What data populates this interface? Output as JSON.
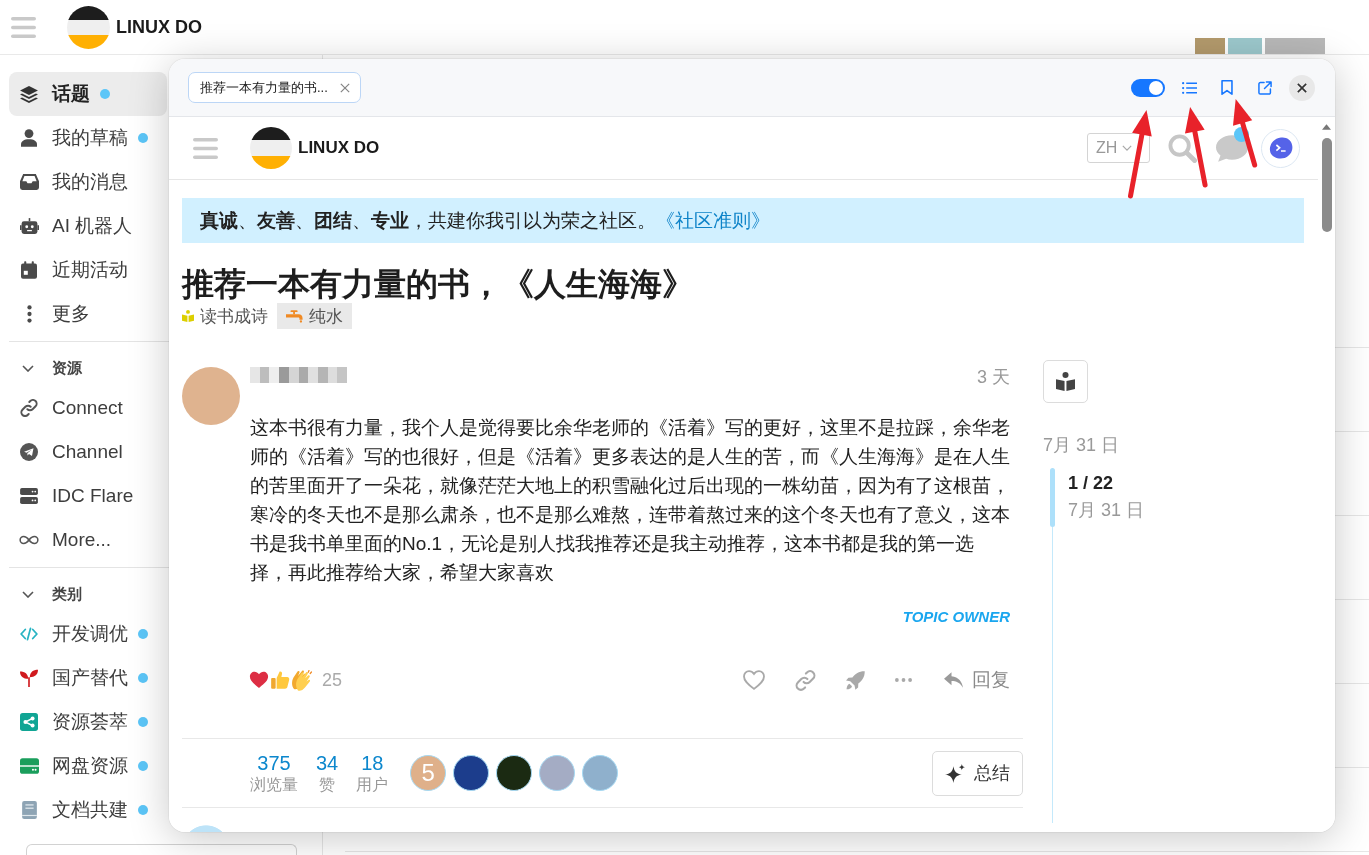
{
  "header": {
    "brand": "LINUX DO"
  },
  "sidebar": {
    "items": [
      {
        "label": "话题",
        "selected": true,
        "unread": true
      },
      {
        "label": "我的草稿",
        "selected": false,
        "unread": true
      },
      {
        "label": "我的消息",
        "selected": false,
        "unread": false
      },
      {
        "label": "AI 机器人",
        "selected": false,
        "unread": false
      },
      {
        "label": "近期活动",
        "selected": false,
        "unread": false
      },
      {
        "label": "更多",
        "selected": false,
        "unread": false
      }
    ],
    "sections": [
      {
        "title": "资源",
        "expanded": true,
        "items": [
          {
            "label": "Connect",
            "selected": false
          },
          {
            "label": "Channel",
            "selected": false
          },
          {
            "label": "IDC Flare",
            "selected": false
          },
          {
            "label": "More...",
            "selected": false
          }
        ]
      },
      {
        "title": "类别",
        "expanded": true,
        "items": [
          {
            "label": "开发调优",
            "color": "#27b3c2",
            "selected": false,
            "unread": true
          },
          {
            "label": "国产替代",
            "color": "#d0191e",
            "selected": false,
            "unread": true
          },
          {
            "label": "资源荟萃",
            "color": "#11a594",
            "selected": false,
            "unread": true
          },
          {
            "label": "网盘资源",
            "color": "#1a9e5c",
            "selected": false,
            "unread": true
          },
          {
            "label": "文档共建",
            "color": "#8ea4b4",
            "selected": false,
            "unread": true
          }
        ]
      }
    ]
  },
  "popup": {
    "tabs": [
      {
        "title": "推荐一本有力量的书...",
        "selected": true
      }
    ],
    "toggle": {
      "on": true
    },
    "site": {
      "brand": "LINUX DO",
      "language": "ZH",
      "unread_notifications": true
    },
    "banner": {
      "text": "**真诚**、**友善**、**团结**、**专业**，共建你我引以为荣之社区。",
      "link": "《社区准则》"
    },
    "topic": {
      "title": "推荐一本有力量的书，《人生海海》",
      "category": {
        "name": "读书成诗",
        "color": "#dccf00"
      },
      "tags": [
        {
          "label": "纯水"
        }
      ]
    },
    "post": {
      "time": "3 天",
      "body": "这本书很有力量，我个人是觉得要比余华老师的《活着》写的更好，这里不是拉踩，余华老师的《活着》写的也很好，但是《活着》更多表达的是人生的苦，而《人生海海》是在人生的苦里面开了一朵花，就像茫茫大地上的积雪融化过后出现的一株幼苗，因为有了这根苗，寒冷的冬天也不是那么肃杀，也不是那么难熬，连带着熬过来的这个冬天也有了意义，这本书是我书单里面的No.1，无论是别人找我推荐还是我主动推荐，这本书都是我的第一选择，再此推荐给大家，希望大家喜欢",
      "badge": "TOPIC OWNER",
      "reactions_count": "25",
      "reply_label": "回复"
    },
    "stats": [
      {
        "value": "375",
        "label": "浏览量"
      },
      {
        "value": "34",
        "label": "赞"
      },
      {
        "value": "18",
        "label": "用户"
      }
    ],
    "participants": [
      {
        "kind": "letter",
        "initial": "5"
      },
      {
        "kind": "photo"
      },
      {
        "kind": "photo"
      },
      {
        "kind": "photo"
      },
      {
        "kind": "photo"
      }
    ],
    "summarize_label": "总结",
    "timeline": {
      "start_date": "7月 31 日",
      "position": "1 / 22",
      "position_date": "7月 31 日"
    }
  }
}
